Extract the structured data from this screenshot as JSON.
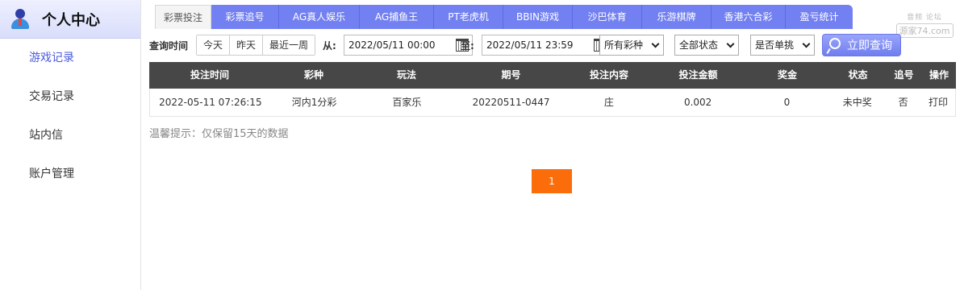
{
  "sidebar": {
    "title": "个人中心",
    "items": [
      {
        "label": "游戏记录"
      },
      {
        "label": "交易记录"
      },
      {
        "label": "站内信"
      },
      {
        "label": "账户管理"
      }
    ]
  },
  "tabs": [
    {
      "label": "彩票投注"
    },
    {
      "label": "彩票追号"
    },
    {
      "label": "AG真人娱乐"
    },
    {
      "label": "AG捕鱼王"
    },
    {
      "label": "PT老虎机"
    },
    {
      "label": "BBIN游戏"
    },
    {
      "label": "沙巴体育"
    },
    {
      "label": "乐游棋牌"
    },
    {
      "label": "香港六合彩"
    },
    {
      "label": "盈亏统计"
    }
  ],
  "watermark": {
    "top": "音频 论坛",
    "bottom": "源家74.com"
  },
  "filters": {
    "label": "查询时间",
    "quick": [
      "今天",
      "昨天",
      "最近一周"
    ],
    "from_label": "从:",
    "from_value": "2022/05/11 00:00",
    "to_label": "至:",
    "to_value": "2022/05/11 23:59",
    "lottery_select": "所有彩种",
    "status_select": "全部状态",
    "single_select": "是否单挑",
    "query_button": "立即查询"
  },
  "table": {
    "headers": [
      "投注时间",
      "彩种",
      "玩法",
      "期号",
      "投注内容",
      "投注金额",
      "奖金",
      "状态",
      "追号",
      "操作"
    ],
    "rows": [
      [
        "2022-05-11 07:26:15",
        "河内1分彩",
        "百家乐",
        "20220511-0447",
        "庄",
        "0.002",
        "0",
        "未中奖",
        "否",
        "打印"
      ]
    ]
  },
  "hint": "温馨提示：仅保留15天的数据",
  "pagination": {
    "current": "1"
  },
  "colors": {
    "accent": "#7280f1",
    "page_button": "#fb6d0b",
    "table_header": "#474747"
  }
}
